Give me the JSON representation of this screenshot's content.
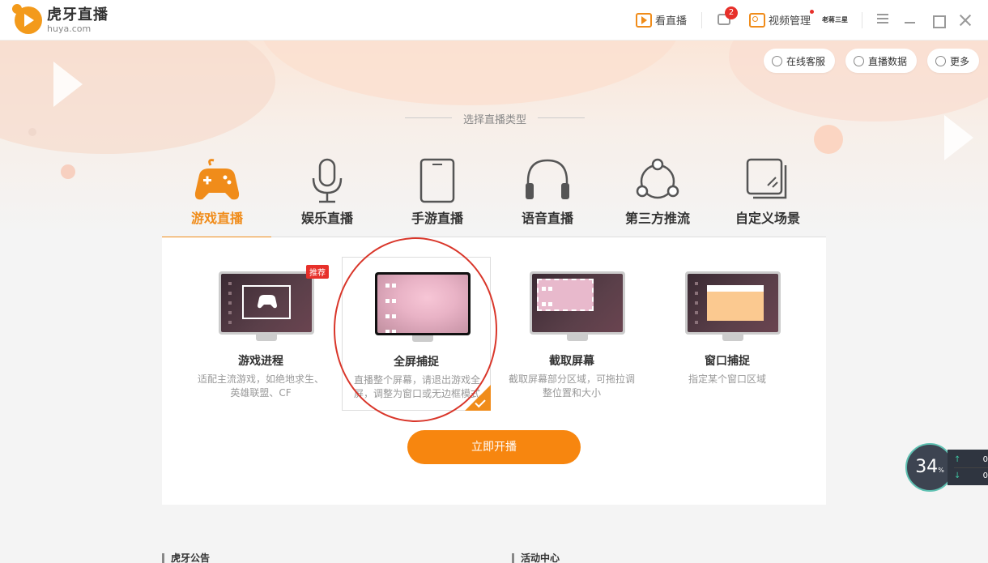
{
  "app": {
    "logo_cn": "虎牙直播",
    "logo_en": "huya.com"
  },
  "titlebar": {
    "watch_live_label": "看直播",
    "message_badge": "2",
    "video_manage_label": "视频管理",
    "avatar_text": "老蒋三星"
  },
  "topright": {
    "service_label": "在线客服",
    "stats_label": "直播数据",
    "more_label": "更多"
  },
  "section_title": "选择直播类型",
  "tabs": [
    {
      "label": "游戏直播",
      "icon": "gamepad-icon"
    },
    {
      "label": "娱乐直播",
      "icon": "microphone-icon"
    },
    {
      "label": "手游直播",
      "icon": "tablet-icon"
    },
    {
      "label": "语音直播",
      "icon": "headphones-icon"
    },
    {
      "label": "第三方推流",
      "icon": "share-icon"
    },
    {
      "label": "自定义场景",
      "icon": "layers-icon"
    }
  ],
  "active_tab": 0,
  "cards": [
    {
      "title": "游戏进程",
      "desc": "适配主流游戏，如绝地求生、英雄联盟、CF",
      "badge": "推荐"
    },
    {
      "title": "全屏捕捉",
      "desc": "直播整个屏幕，请退出游戏全屏，调整为窗口或无边框模式"
    },
    {
      "title": "截取屏幕",
      "desc": "截取屏幕部分区域，可拖拉调整位置和大小"
    },
    {
      "title": "窗口捕捉",
      "desc": "指定某个窗口区域"
    }
  ],
  "start_button": "立即开播",
  "bottom": {
    "announcement": "虎牙公告",
    "activity": "活动中心"
  },
  "speed_widget": {
    "percent": "34",
    "unit": "%",
    "up": "0",
    "down": "0"
  },
  "colors": {
    "accent": "#f08c1a",
    "badge_red": "#e7302a",
    "button": "#f7860f"
  }
}
